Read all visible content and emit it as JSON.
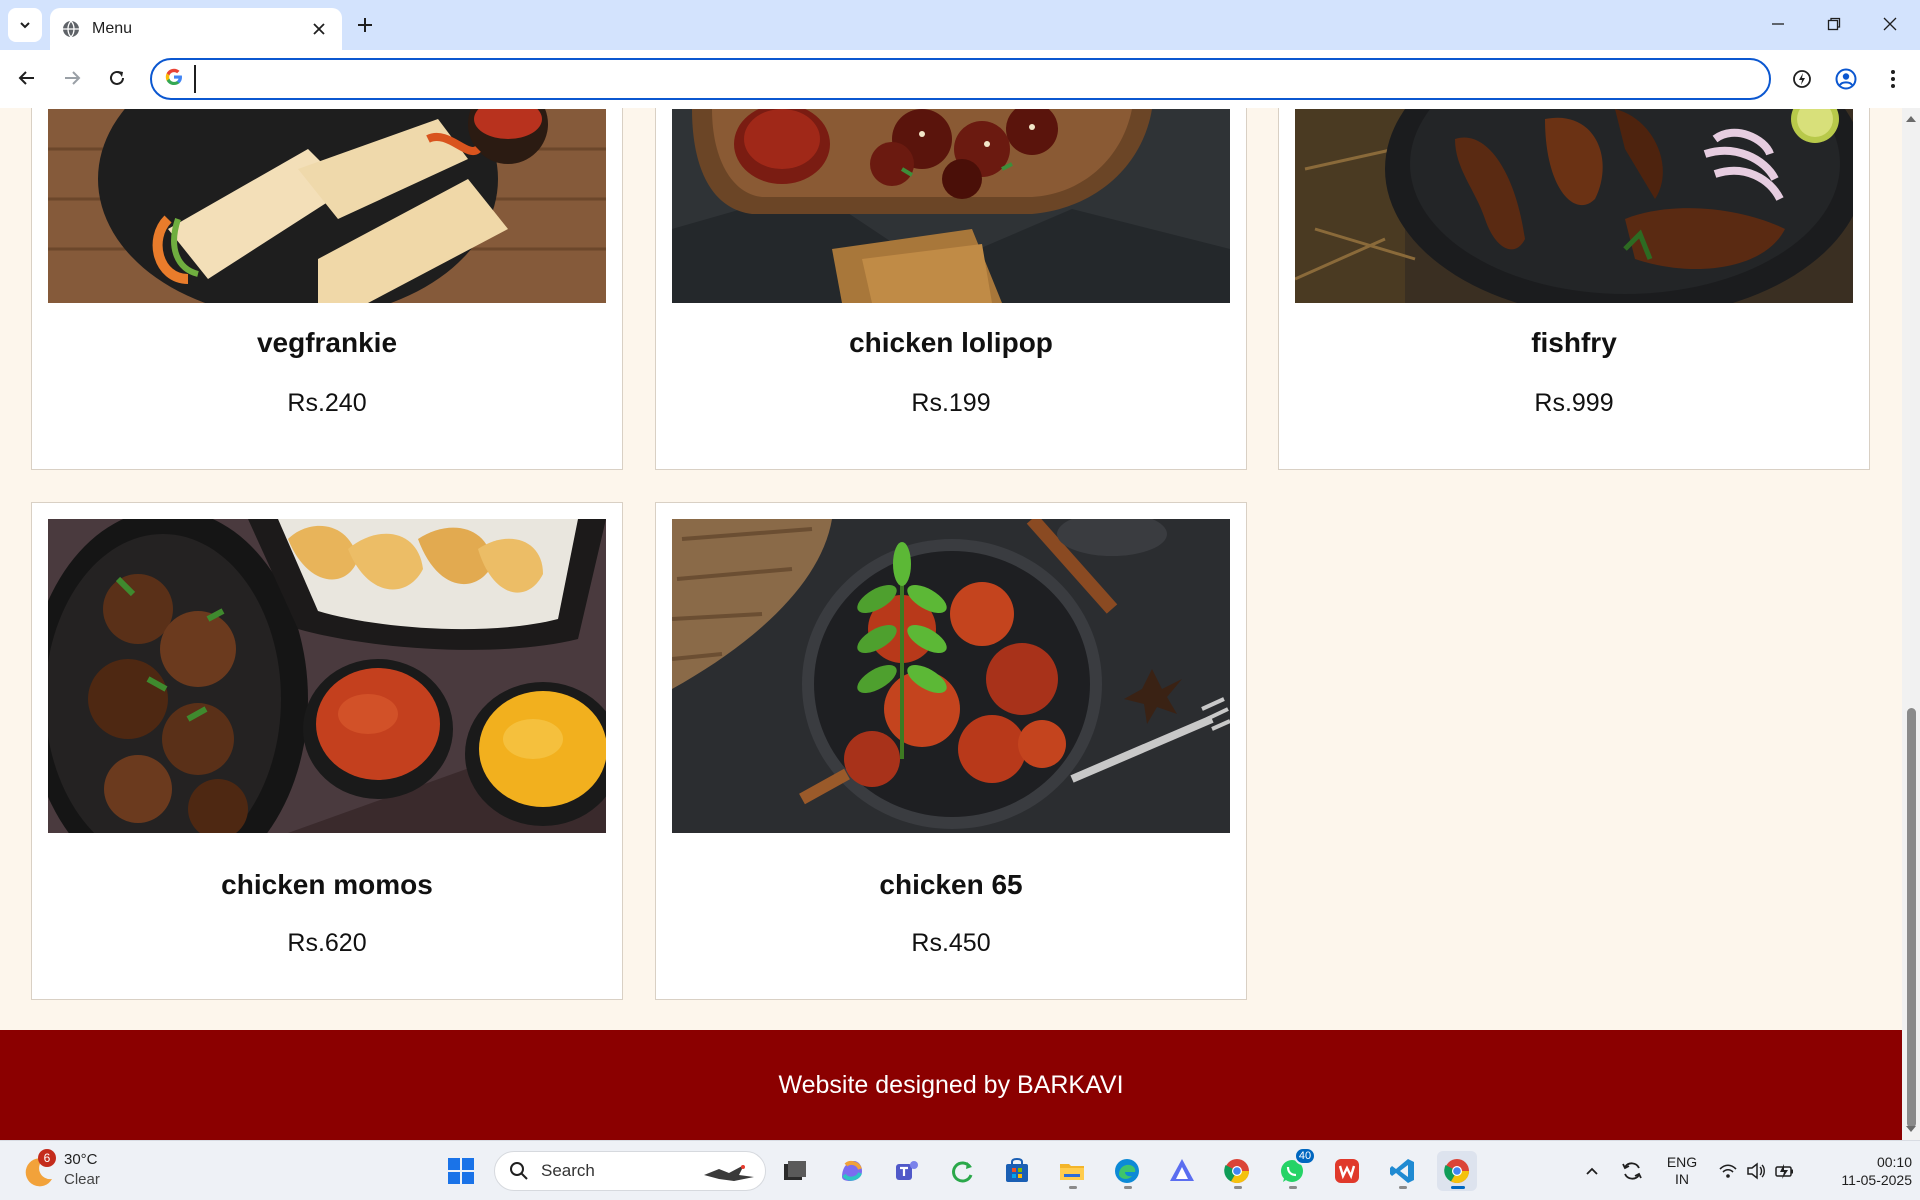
{
  "browser": {
    "tab_title": "Menu",
    "omnibox_value": "",
    "omnibox_placeholder": ""
  },
  "menu": {
    "items": [
      {
        "name": "vegfrankie",
        "price": "Rs.240",
        "image": "veg-frankie-wraps-photo"
      },
      {
        "name": "chicken lolipop",
        "price": "Rs.199",
        "image": "chicken-lollipop-photo"
      },
      {
        "name": "fishfry",
        "price": "Rs.999",
        "image": "fish-fry-photo"
      },
      {
        "name": "chicken momos",
        "price": "Rs.620",
        "image": "chicken-momos-photo"
      },
      {
        "name": "chicken 65",
        "price": "Rs.450",
        "image": "chicken-65-photo"
      }
    ]
  },
  "footer": {
    "text": "Website designed by BARKAVI"
  },
  "taskbar": {
    "weather_temp": "30°C",
    "weather_desc": "Clear",
    "weather_badge": "6",
    "search_label": "Search",
    "whatsapp_badge": "40",
    "lang_line1": "ENG",
    "lang_line2": "IN",
    "time": "00:10",
    "date": "11-05-2025"
  },
  "colors": {
    "page_bg": "#fdf6ec",
    "footer_bg": "#8b0000",
    "accent": "#0b57d0"
  }
}
